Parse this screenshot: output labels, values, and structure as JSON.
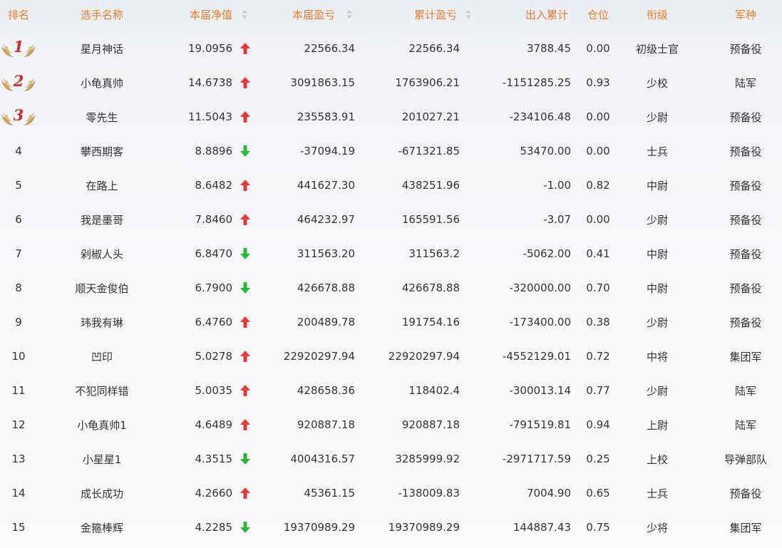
{
  "table": {
    "columns": {
      "rank": "排名",
      "name": "选手名称",
      "nav": "本届净值",
      "current_pl": "本届盈亏",
      "cumulative_pl": "累计盈亏",
      "flow": "出入累计",
      "position": "仓位",
      "title": "衔级",
      "arm": "军种"
    },
    "sorted_columns": [
      "nav",
      "current_pl",
      "cumulative_pl"
    ],
    "colors": {
      "header_text": "#ee7c2e",
      "up_arrow": "#e8383d",
      "down_arrow": "#2db83d",
      "medal_number": "#d5282a",
      "wing": "#c8a86a"
    },
    "rows": [
      {
        "rank": "1",
        "medal": true,
        "name": "星月神话",
        "nav": "19.0956",
        "trend": "up",
        "current_pl": "22566.34",
        "cumulative_pl": "22566.34",
        "flow": "3788.45",
        "position": "0.00",
        "title": "初级士官",
        "arm": "预备役"
      },
      {
        "rank": "2",
        "medal": true,
        "name": "小龟真帅",
        "nav": "14.6738",
        "trend": "up",
        "current_pl": "3091863.15",
        "cumulative_pl": "1763906.21",
        "flow": "-1151285.25",
        "position": "0.93",
        "title": "少校",
        "arm": "陆军"
      },
      {
        "rank": "3",
        "medal": true,
        "name": "零先生",
        "nav": "11.5043",
        "trend": "up",
        "current_pl": "235583.91",
        "cumulative_pl": "201027.21",
        "flow": "-234106.48",
        "position": "0.00",
        "title": "少尉",
        "arm": "预备役"
      },
      {
        "rank": "4",
        "medal": false,
        "name": "攀西期客",
        "nav": "8.8896",
        "trend": "down",
        "current_pl": "-37094.19",
        "cumulative_pl": "-671321.85",
        "flow": "53470.00",
        "position": "0.00",
        "title": "士兵",
        "arm": "预备役"
      },
      {
        "rank": "5",
        "medal": false,
        "name": "在路上",
        "nav": "8.6482",
        "trend": "up",
        "current_pl": "441627.30",
        "cumulative_pl": "438251.96",
        "flow": "-1.00",
        "position": "0.82",
        "title": "中尉",
        "arm": "预备役"
      },
      {
        "rank": "6",
        "medal": false,
        "name": "我是墨哥",
        "nav": "7.8460",
        "trend": "up",
        "current_pl": "464232.97",
        "cumulative_pl": "165591.56",
        "flow": "-3.07",
        "position": "0.00",
        "title": "少尉",
        "arm": "预备役"
      },
      {
        "rank": "7",
        "medal": false,
        "name": "剁椒人头",
        "nav": "6.8470",
        "trend": "down",
        "current_pl": "311563.20",
        "cumulative_pl": "311563.2",
        "flow": "-5062.00",
        "position": "0.41",
        "title": "中尉",
        "arm": "预备役"
      },
      {
        "rank": "8",
        "medal": false,
        "name": "顺天金俊伯",
        "nav": "6.7900",
        "trend": "down",
        "current_pl": "426678.88",
        "cumulative_pl": "426678.88",
        "flow": "-320000.00",
        "position": "0.70",
        "title": "中尉",
        "arm": "预备役"
      },
      {
        "rank": "9",
        "medal": false,
        "name": "玮我有琳",
        "nav": "6.4760",
        "trend": "up",
        "current_pl": "200489.78",
        "cumulative_pl": "191754.16",
        "flow": "-173400.00",
        "position": "0.38",
        "title": "少尉",
        "arm": "预备役"
      },
      {
        "rank": "10",
        "medal": false,
        "name": "凹印",
        "nav": "5.0278",
        "trend": "up",
        "current_pl": "22920297.94",
        "cumulative_pl": "22920297.94",
        "flow": "-4552129.01",
        "position": "0.72",
        "title": "中将",
        "arm": "集团军"
      },
      {
        "rank": "11",
        "medal": false,
        "name": "不犯同样错",
        "nav": "5.0035",
        "trend": "up",
        "current_pl": "428658.36",
        "cumulative_pl": "118402.4",
        "flow": "-300013.14",
        "position": "0.77",
        "title": "少尉",
        "arm": "陆军"
      },
      {
        "rank": "12",
        "medal": false,
        "name": "小龟真帅1",
        "nav": "4.6489",
        "trend": "up",
        "current_pl": "920887.18",
        "cumulative_pl": "920887.18",
        "flow": "-791519.81",
        "position": "0.94",
        "title": "上尉",
        "arm": "陆军"
      },
      {
        "rank": "13",
        "medal": false,
        "name": "小星星1",
        "nav": "4.3515",
        "trend": "down",
        "current_pl": "4004316.57",
        "cumulative_pl": "3285999.92",
        "flow": "-2971717.59",
        "position": "0.25",
        "title": "上校",
        "arm": "导弹部队"
      },
      {
        "rank": "14",
        "medal": false,
        "name": "成长成功",
        "nav": "4.2660",
        "trend": "up",
        "current_pl": "45361.15",
        "cumulative_pl": "-138009.83",
        "flow": "7004.90",
        "position": "0.65",
        "title": "士兵",
        "arm": "预备役"
      },
      {
        "rank": "15",
        "medal": false,
        "name": "金箍棒辉",
        "nav": "4.2285",
        "trend": "down",
        "current_pl": "19370989.29",
        "cumulative_pl": "19370989.29",
        "flow": "144887.43",
        "position": "0.75",
        "title": "少将",
        "arm": "集团军"
      }
    ]
  }
}
